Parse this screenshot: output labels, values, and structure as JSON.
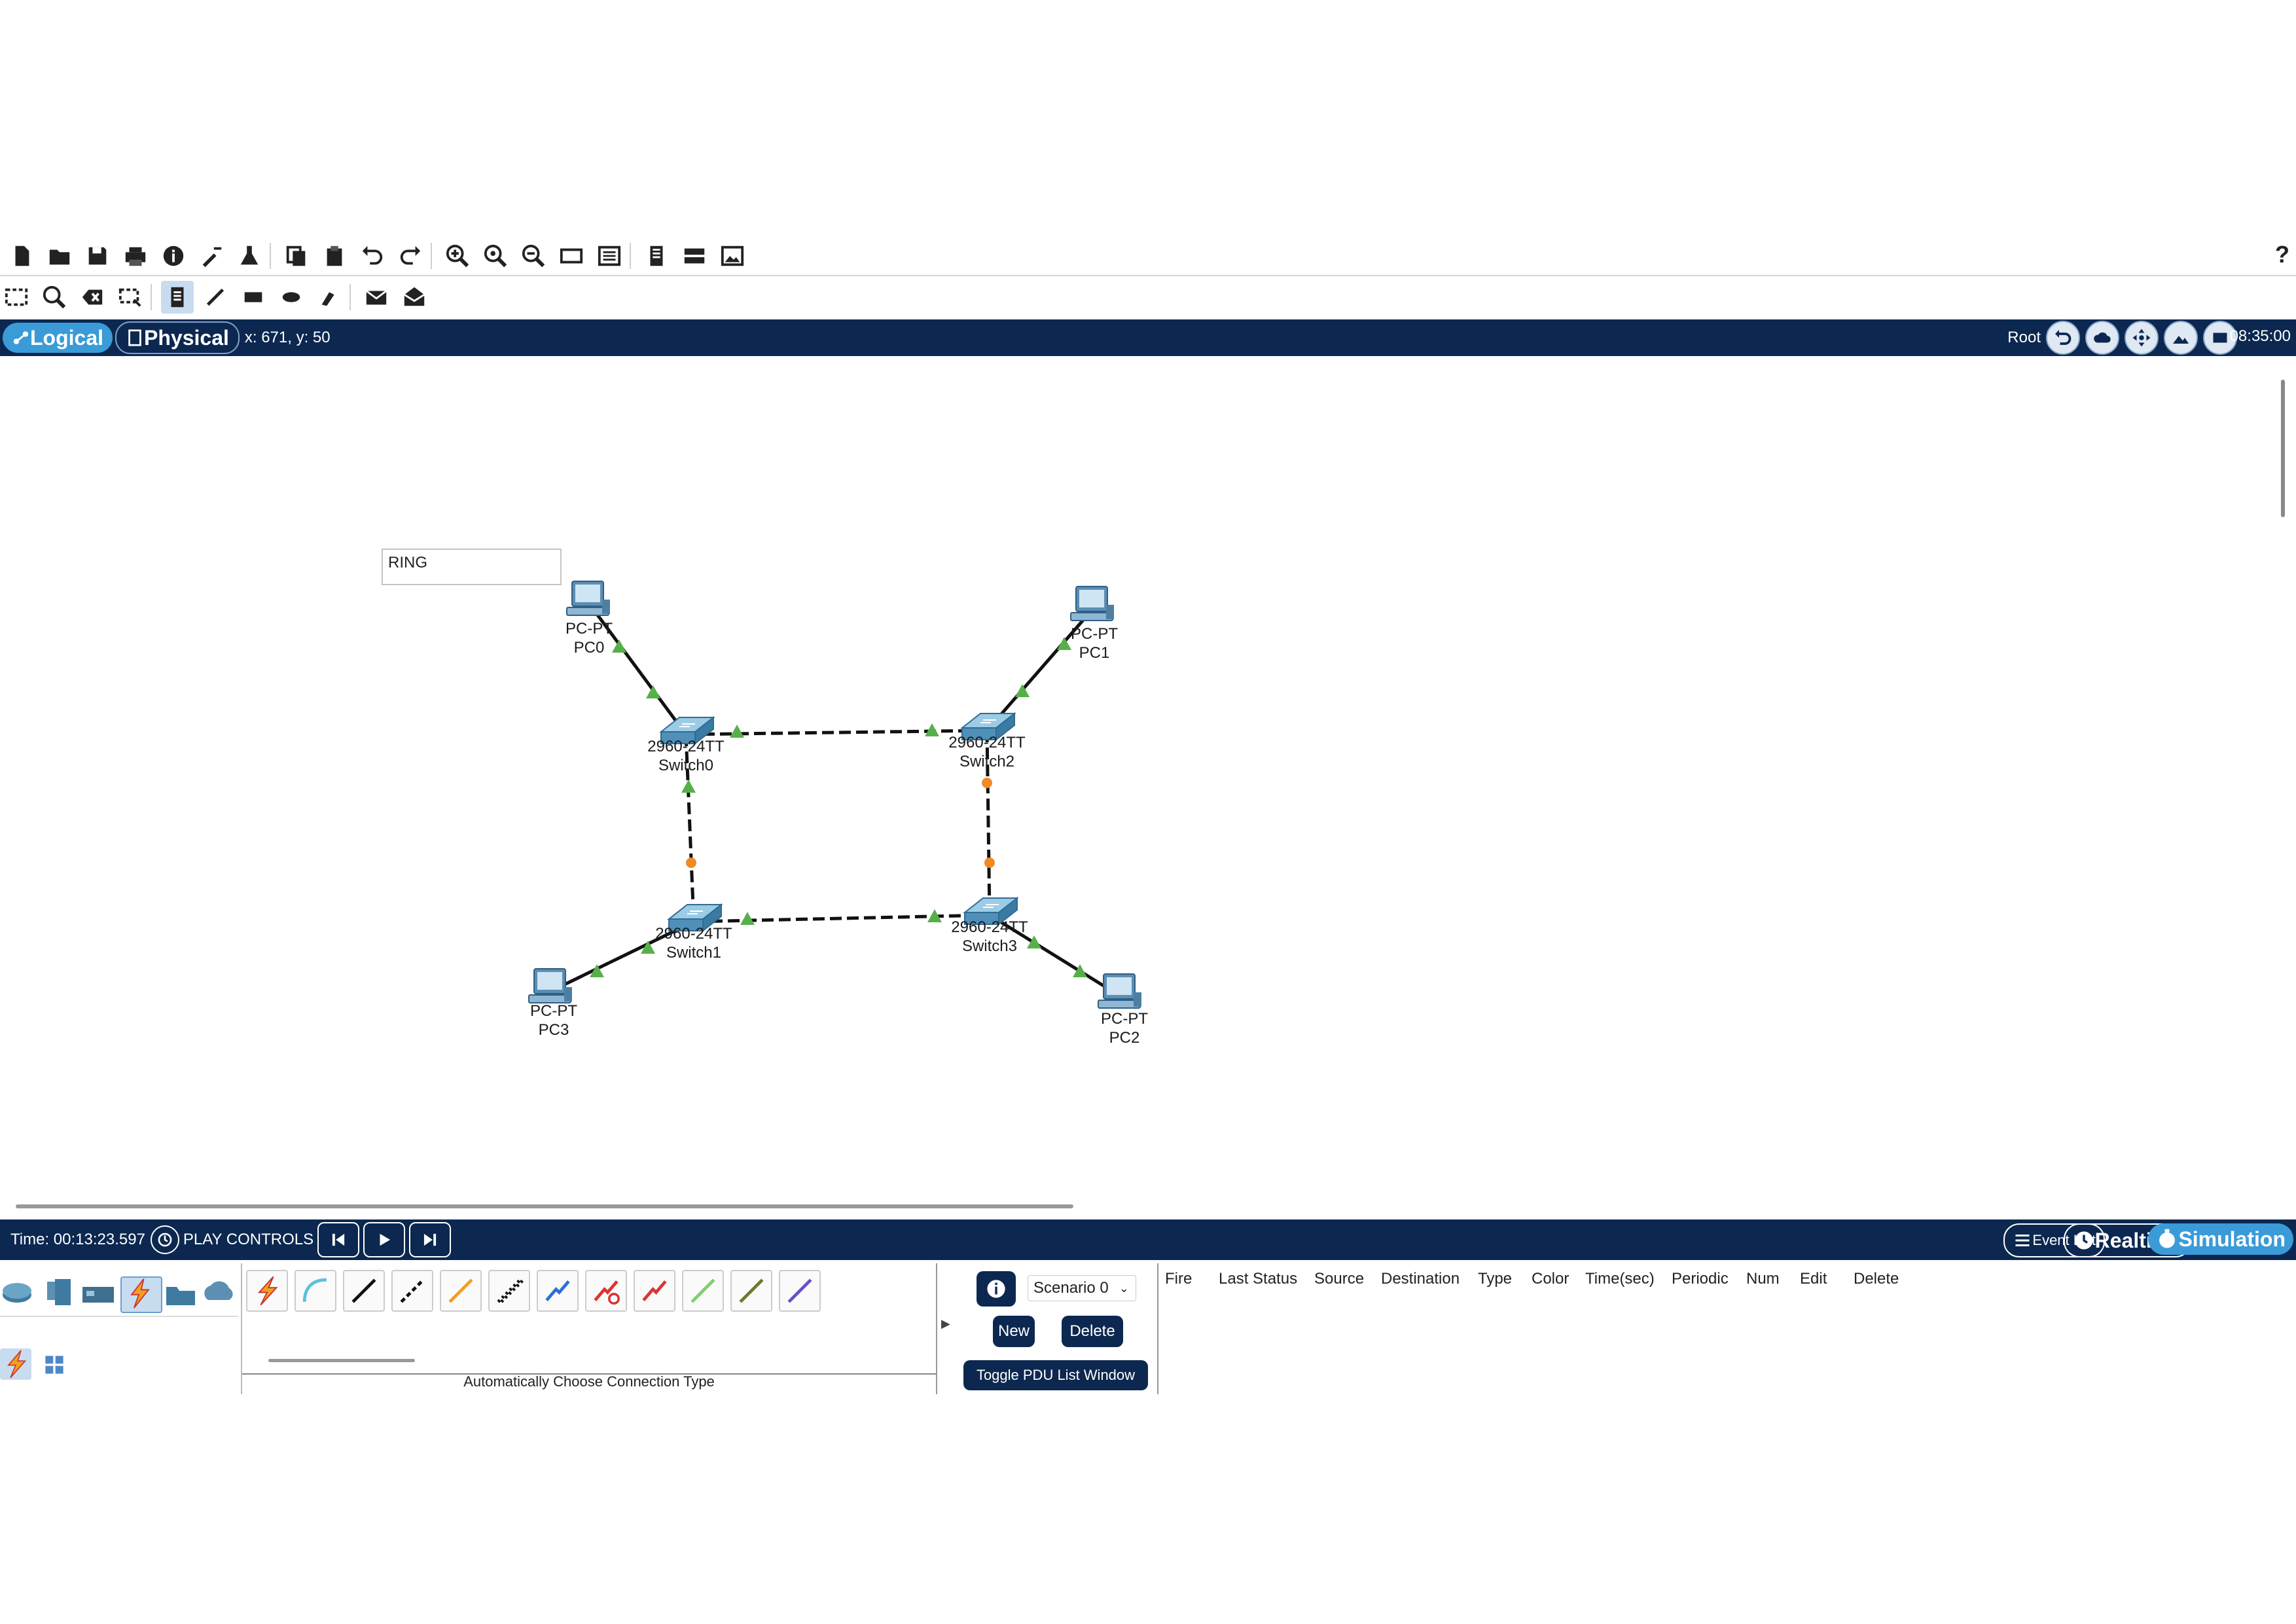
{
  "toolbar1": {
    "icons": [
      "new-file-icon",
      "open-folder-icon",
      "save-icon",
      "print-icon",
      "info-icon",
      "wizard-icon",
      "chemistry-icon",
      "copy-icon",
      "paste-icon",
      "undo-icon",
      "redo-icon",
      "zoom-in-icon",
      "zoom-reset-icon",
      "zoom-out-icon",
      "drawing-palette-icon",
      "custom-device-icon",
      "view-icon",
      "cluster-icon",
      "screenshot-icon"
    ],
    "help": "?"
  },
  "toolbar2": {
    "icons": [
      "select-icon",
      "inspect-icon",
      "delete-icon",
      "resize-icon",
      "place-note-icon",
      "draw-line-icon",
      "draw-rectangle-icon",
      "draw-ellipse-icon",
      "freeform-icon",
      "simple-pdu-icon",
      "complex-pdu-icon"
    ]
  },
  "workspace": {
    "logical": "Logical",
    "physical": "Physical",
    "coords": "x: 671, y: 50",
    "root": "Root",
    "clock": "08:35:00"
  },
  "canvas": {
    "note": "RING",
    "devices": [
      {
        "id": "pc0",
        "model": "PC-PT",
        "name": "PC0"
      },
      {
        "id": "pc1",
        "model": "PC-PT",
        "name": "PC1"
      },
      {
        "id": "sw0",
        "model": "2960-24TT",
        "name": "Switch0"
      },
      {
        "id": "sw2",
        "model": "2960-24TT",
        "name": "Switch2"
      },
      {
        "id": "sw1",
        "model": "2960-24TT",
        "name": "Switch1"
      },
      {
        "id": "sw3",
        "model": "2960-24TT",
        "name": "Switch3"
      },
      {
        "id": "pc3",
        "model": "PC-PT",
        "name": "PC3"
      },
      {
        "id": "pc2",
        "model": "PC-PT",
        "name": "PC2"
      }
    ],
    "colors": {
      "link_up": "#56b04a",
      "link_blocked": "#f08a24"
    }
  },
  "sim": {
    "time": "Time: 00:13:23.597",
    "play_controls": "PLAY CONTROLS",
    "event_list": "Event List",
    "realtime": "Realtime",
    "simulation": "Simulation"
  },
  "connections": {
    "caption": "Automatically Choose Connection Type"
  },
  "pdu": {
    "scenario": "Scenario 0",
    "new": "New",
    "delete": "Delete",
    "toggle": "Toggle PDU List Window",
    "columns": [
      "Fire",
      "Last Status",
      "Source",
      "Destination",
      "Type",
      "Color",
      "Time(sec)",
      "Periodic",
      "Num",
      "Edit",
      "Delete"
    ]
  }
}
